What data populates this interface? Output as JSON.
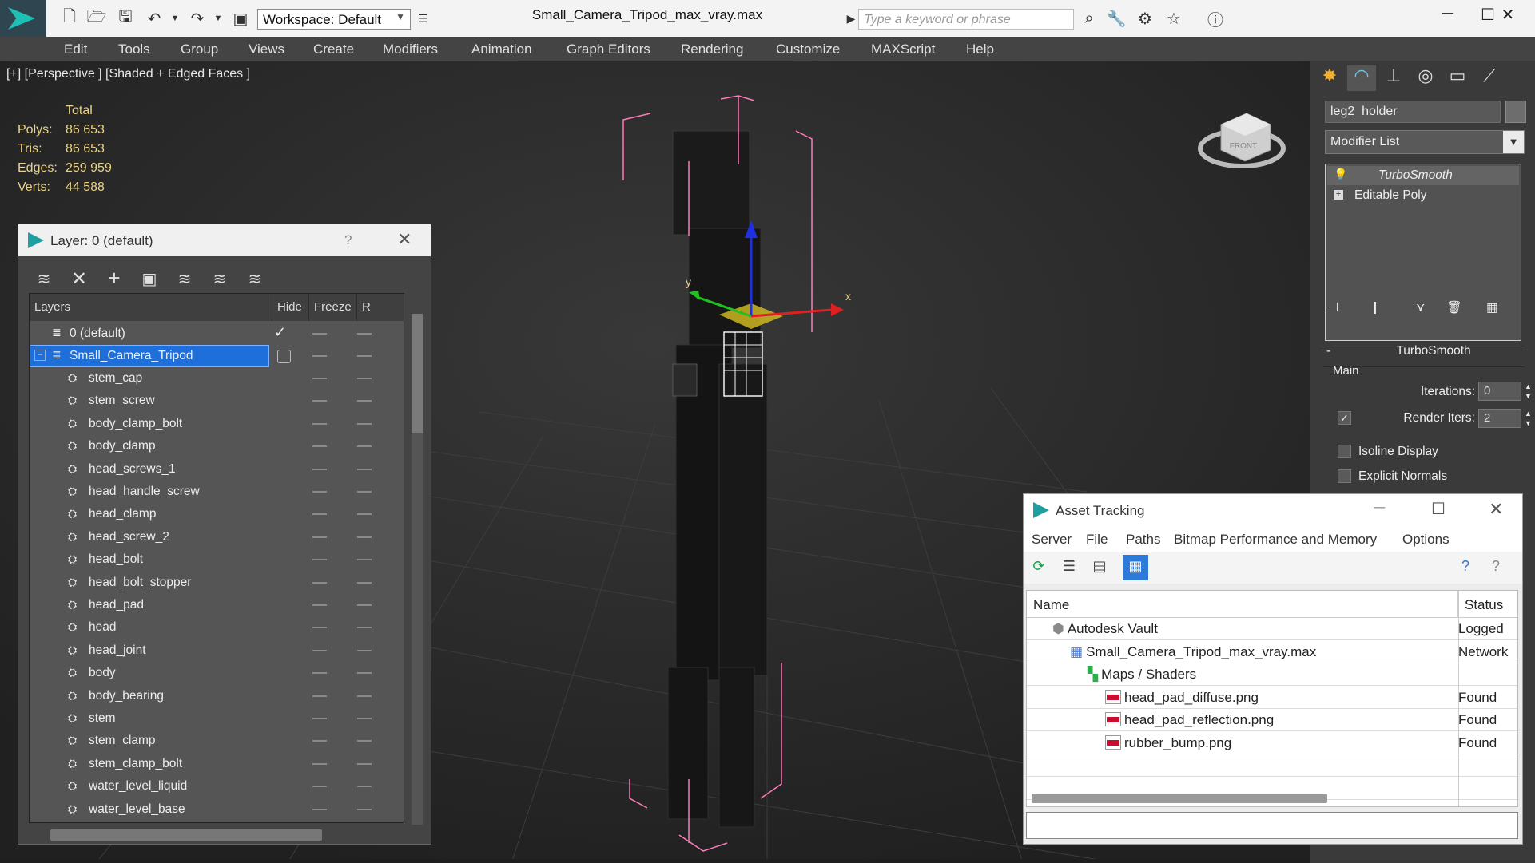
{
  "titlebar": {
    "workspace": "Workspace: Default",
    "file_title": "Small_Camera_Tripod_max_vray.max",
    "search_placeholder": "Type a keyword or phrase"
  },
  "menu": [
    "Edit",
    "Tools",
    "Group",
    "Views",
    "Create",
    "Modifiers",
    "Animation",
    "Graph Editors",
    "Rendering",
    "Customize",
    "MAXScript",
    "Help"
  ],
  "viewport": {
    "label": "[+] [Perspective ] [Shaded + Edged Faces ]",
    "stats_header": "Total",
    "stats": [
      {
        "label": "Polys:",
        "value": "86 653"
      },
      {
        "label": "Tris:",
        "value": "86 653"
      },
      {
        "label": "Edges:",
        "value": "259 959"
      },
      {
        "label": "Verts:",
        "value": "44 588"
      }
    ],
    "axis_x": "x",
    "axis_y": "y",
    "viewcube_label": "FRONT"
  },
  "layer_dialog": {
    "title": "Layer: 0 (default)",
    "help": "?",
    "columns": {
      "layers": "Layers",
      "hide": "Hide",
      "freeze": "Freeze",
      "render": "R"
    },
    "default_layer": "0 (default)",
    "active_layer": "Small_Camera_Tripod",
    "objects": [
      "stem_cap",
      "stem_screw",
      "body_clamp_bolt",
      "body_clamp",
      "head_screws_1",
      "head_handle_screw",
      "head_clamp",
      "head_screw_2",
      "head_bolt",
      "head_bolt_stopper",
      "head_pad",
      "head",
      "head_joint",
      "body",
      "body_bearing",
      "stem",
      "stem_clamp",
      "stem_clamp_bolt",
      "water_level_liquid",
      "water_level_base"
    ]
  },
  "command_panel": {
    "object_name": "leg2_holder",
    "modifier_list": "Modifier List",
    "stack": [
      "TurboSmooth",
      "Editable Poly"
    ],
    "rollout_title": "TurboSmooth",
    "group_main": "Main",
    "iterations_label": "Iterations:",
    "iterations_value": "0",
    "render_iters_label": "Render Iters:",
    "render_iters_value": "2",
    "render_iters_checked": true,
    "isoline_label": "Isoline Display",
    "isoline_checked": false,
    "explicit_normals_label": "Explicit Normals",
    "explicit_normals_checked": false,
    "collapse": "-"
  },
  "asset_tracking": {
    "title": "Asset Tracking",
    "menu": [
      "Server",
      "File",
      "Paths",
      "Bitmap Performance and Memory",
      "Options"
    ],
    "col_name": "Name",
    "col_status": "Status",
    "rows": [
      {
        "name": "Autodesk Vault",
        "status": "Logged",
        "indent": 1,
        "icon": "vault-icon"
      },
      {
        "name": "Small_Camera_Tripod_max_vray.max",
        "status": "Network",
        "indent": 2,
        "icon": "max-file-icon"
      },
      {
        "name": "Maps / Shaders",
        "status": "",
        "indent": 3,
        "icon": "maps-icon"
      },
      {
        "name": "head_pad_diffuse.png",
        "status": "Found",
        "indent": 4,
        "icon": "png-icon"
      },
      {
        "name": "head_pad_reflection.png",
        "status": "Found",
        "indent": 4,
        "icon": "png-icon"
      },
      {
        "name": "rubber_bump.png",
        "status": "Found",
        "indent": 4,
        "icon": "png-icon"
      }
    ]
  },
  "colors": {
    "selection_blue": "#1e6fd9",
    "bounding_box": "#ff7ab8",
    "stats_text": "#e8d38a"
  }
}
